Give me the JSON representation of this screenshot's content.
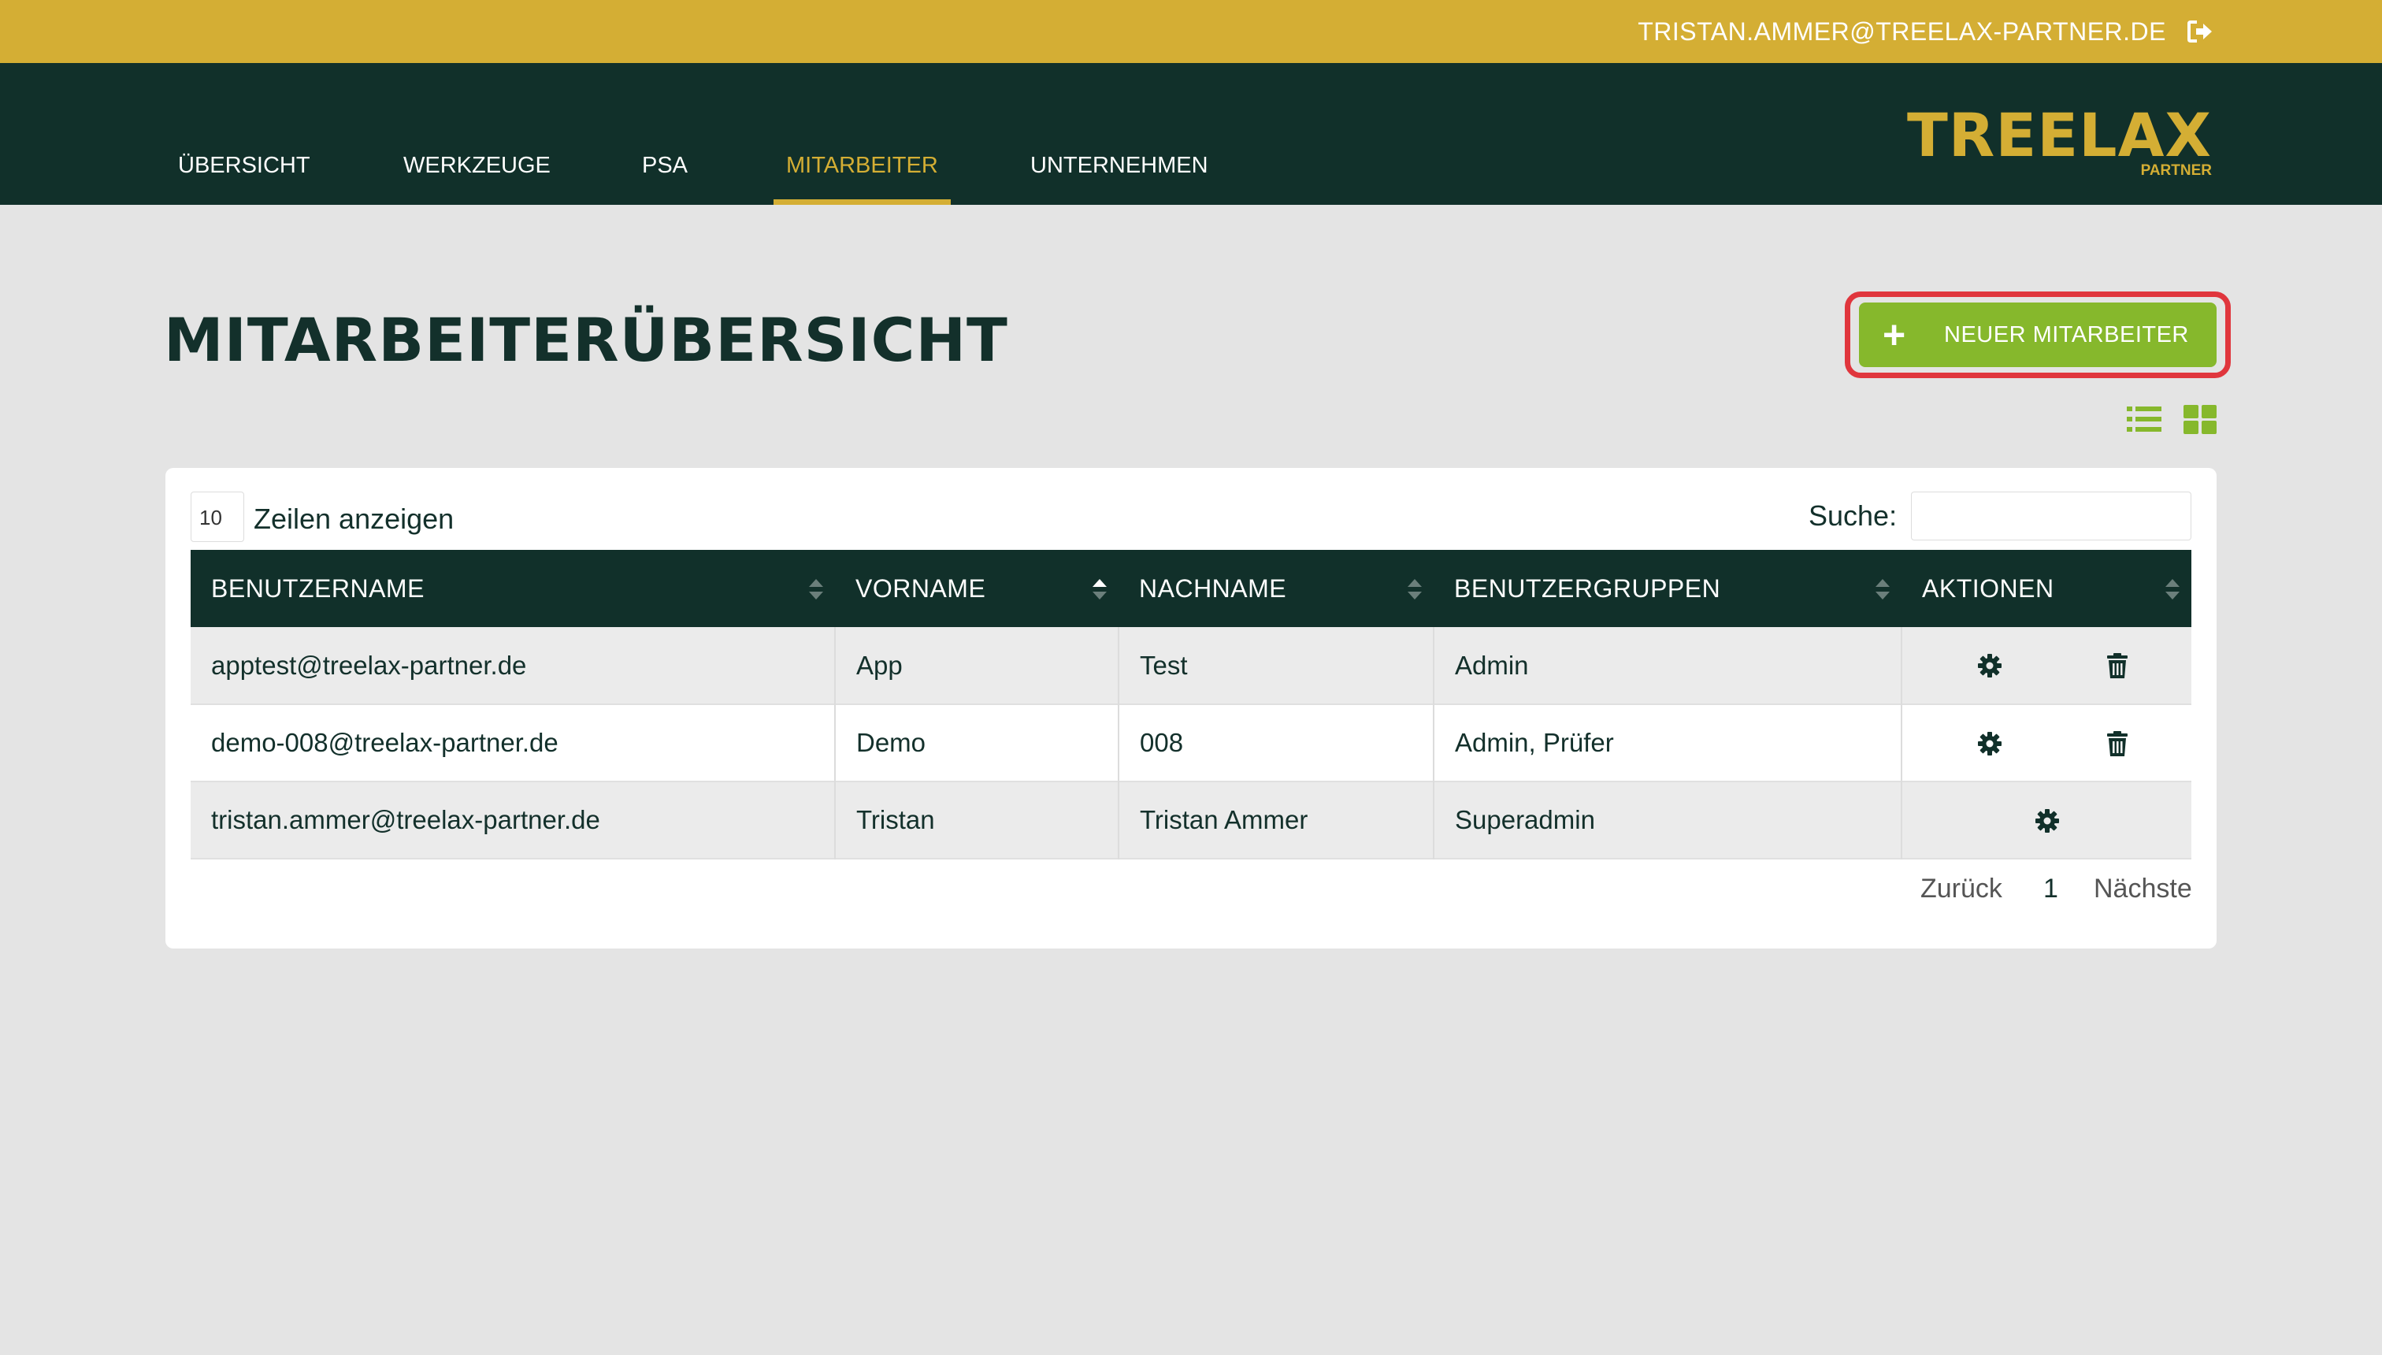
{
  "topbar": {
    "user_email": "TRISTAN.AMMER@TREELAX-PARTNER.DE",
    "logout_icon": "logout-icon"
  },
  "nav": {
    "tabs": [
      {
        "label": "ÜBERSICHT",
        "active": false
      },
      {
        "label": "WERKZEUGE",
        "active": false
      },
      {
        "label": "PSA",
        "active": false
      },
      {
        "label": "MITARBEITER",
        "active": true
      },
      {
        "label": "UNTERNEHMEN",
        "active": false
      }
    ],
    "logo": {
      "brand": "TREELAX",
      "sub": "PARTNER"
    }
  },
  "page": {
    "title": "MITARBEITERÜBERSICHT",
    "new_button_label": "NEUER MITARBEITER",
    "new_button_icon": "plus-icon"
  },
  "view_toggle": {
    "list_icon": "list-view-icon",
    "grid_icon": "grid-view-icon"
  },
  "table": {
    "page_length": "10",
    "page_length_label": "Zeilen anzeigen",
    "search_label": "Suche:",
    "search_value": "",
    "columns": [
      "BENUTZERNAME",
      "VORNAME",
      "NACHNAME",
      "BENUTZERGRUPPEN",
      "AKTIONEN"
    ],
    "rows": [
      {
        "username": "apptest@treelax-partner.de",
        "firstname": "App",
        "lastname": "Test",
        "groups": "Admin",
        "actions": [
          "settings",
          "delete"
        ]
      },
      {
        "username": "demo-008@treelax-partner.de",
        "firstname": "Demo",
        "lastname": "008",
        "groups": "Admin, Prüfer",
        "actions": [
          "settings",
          "delete"
        ]
      },
      {
        "username": "tristan.ammer@treelax-partner.de",
        "firstname": "Tristan",
        "lastname": "Tristan Ammer",
        "groups": "Superadmin",
        "actions": [
          "settings"
        ]
      }
    ],
    "pagination": {
      "prev": "Zurück",
      "current": "1",
      "next": "Nächste"
    }
  },
  "colors": {
    "topbar": "#d4ae34",
    "nav": "#11302a",
    "accent": "#d4ae34",
    "button": "#86b82c",
    "highlight": "#e0363d",
    "background": "#e4e4e4"
  }
}
